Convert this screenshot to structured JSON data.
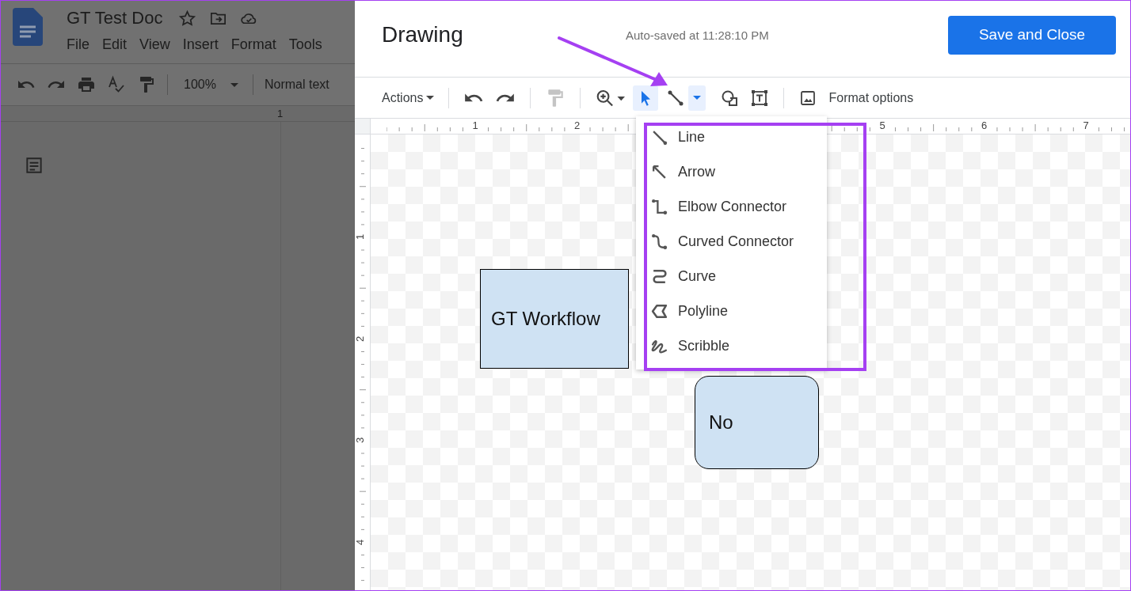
{
  "docs": {
    "title": "GT Test Doc",
    "menu": [
      "File",
      "Edit",
      "View",
      "Insert",
      "Format",
      "Tools"
    ],
    "zoom": "100%",
    "style": "Normal text",
    "ruler": [
      "1"
    ]
  },
  "dialog": {
    "title": "Drawing",
    "autosave": "Auto-saved at 11:28:10 PM",
    "save_button": "Save and Close",
    "toolbar": [
      {
        "kind": "actions",
        "label": "Actions"
      },
      {
        "kind": "undo",
        "disabled": false
      },
      {
        "kind": "redo",
        "disabled": false
      },
      {
        "kind": "paint",
        "disabled": true
      },
      {
        "kind": "zoom",
        "disabled": false
      },
      {
        "kind": "select",
        "selected": true
      },
      {
        "kind": "line",
        "selected": false,
        "expanded": true
      },
      {
        "kind": "shape",
        "selected": false
      },
      {
        "kind": "textbox",
        "selected": false
      },
      {
        "kind": "image",
        "selected": false
      },
      {
        "kind": "format",
        "label": "Format options"
      }
    ],
    "ruler_h": [
      "1",
      "2",
      "5",
      "6",
      "7"
    ],
    "ruler_v": [
      "1",
      "2",
      "3",
      "4"
    ],
    "shapes": [
      {
        "kind": "rectangle",
        "text": "GT Workflow"
      },
      {
        "kind": "rounded",
        "text": "No"
      }
    ],
    "line_menu": [
      {
        "kind": "line",
        "label": "Line"
      },
      {
        "kind": "arrow",
        "label": "Arrow"
      },
      {
        "kind": "elbow",
        "label": "Elbow Connector"
      },
      {
        "kind": "curved",
        "label": "Curved Connector"
      },
      {
        "kind": "curve",
        "label": "Curve"
      },
      {
        "kind": "polyline",
        "label": "Polyline"
      },
      {
        "kind": "scribble",
        "label": "Scribble"
      }
    ]
  }
}
